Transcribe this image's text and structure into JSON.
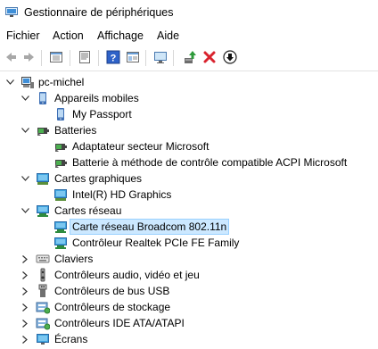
{
  "window": {
    "title": "Gestionnaire de périphériques"
  },
  "menu": [
    "Fichier",
    "Action",
    "Affichage",
    "Aide"
  ],
  "toolbar": [
    "back-icon",
    "forward-icon",
    "view-icon",
    "properties-icon",
    "help-icon",
    "view-list-icon",
    "monitor-icon",
    "update-driver-icon",
    "uninstall-icon",
    "disable-icon"
  ],
  "tree": {
    "root": "pc-michel",
    "nodes": [
      {
        "label": "Appareils mobiles",
        "icon": "mobile-icon",
        "expanded": true,
        "children": [
          "My Passport"
        ],
        "child_icon": "mobile-icon"
      },
      {
        "label": "Batteries",
        "icon": "battery-icon",
        "expanded": true,
        "children": [
          "Adaptateur secteur Microsoft",
          "Batterie à méthode de contrôle compatible ACPI Microsoft"
        ],
        "child_icon": "battery-icon"
      },
      {
        "label": "Cartes graphiques",
        "icon": "display-adapter-icon",
        "expanded": true,
        "children": [
          "Intel(R) HD Graphics"
        ],
        "child_icon": "display-adapter-icon"
      },
      {
        "label": "Cartes réseau",
        "icon": "network-adapter-icon",
        "expanded": true,
        "children": [
          "Carte réseau Broadcom 802.11n",
          "Contrôleur Realtek PCIe FE Family"
        ],
        "child_icon": "network-adapter-icon",
        "selected_child": 0
      },
      {
        "label": "Claviers",
        "icon": "keyboard-icon",
        "expanded": false
      },
      {
        "label": "Contrôleurs audio, vidéo et jeu",
        "icon": "audio-icon",
        "expanded": false
      },
      {
        "label": "Contrôleurs de bus USB",
        "icon": "usb-icon",
        "expanded": false
      },
      {
        "label": "Contrôleurs de stockage",
        "icon": "storage-icon",
        "expanded": false
      },
      {
        "label": "Contrôleurs IDE ATA/ATAPI",
        "icon": "ide-icon",
        "expanded": false
      },
      {
        "label": "Écrans",
        "icon": "monitor-icon",
        "expanded": false
      }
    ]
  }
}
